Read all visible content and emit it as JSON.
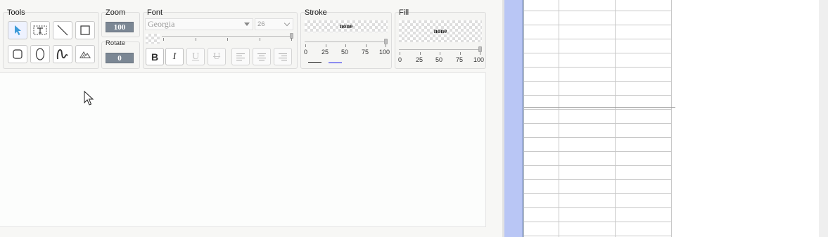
{
  "toolbar": {
    "tools": {
      "title": "Tools",
      "items": [
        {
          "name": "select-tool",
          "icon": "pointer-icon",
          "active": true
        },
        {
          "name": "text-tool",
          "icon": "text-box-icon",
          "active": false
        },
        {
          "name": "line-tool",
          "icon": "line-icon",
          "active": false
        },
        {
          "name": "rectangle-tool",
          "icon": "rectangle-icon",
          "active": false
        },
        {
          "name": "rounded-rectangle-tool",
          "icon": "rounded-rectangle-icon",
          "active": false
        },
        {
          "name": "ellipse-tool",
          "icon": "ellipse-icon",
          "active": false
        },
        {
          "name": "freehand-tool",
          "icon": "freehand-icon",
          "active": false
        },
        {
          "name": "image-tool",
          "icon": "image-icon",
          "active": false
        }
      ]
    },
    "zoom": {
      "title": "Zoom",
      "value": "100",
      "rotate_label": "Rotate",
      "rotate_value": "0"
    },
    "font": {
      "title": "Font",
      "family": "Georgia",
      "size": "26",
      "buttons": [
        {
          "name": "bold",
          "label": "B"
        },
        {
          "name": "italic",
          "label": "I"
        },
        {
          "name": "underline",
          "label": "U"
        },
        {
          "name": "strikethrough",
          "label": "U"
        },
        {
          "name": "align-left",
          "icon": "align-left-icon"
        },
        {
          "name": "align-center",
          "icon": "align-center-icon"
        },
        {
          "name": "align-right",
          "icon": "align-right-icon"
        }
      ]
    },
    "stroke": {
      "title": "Stroke",
      "color_label": "none",
      "opacity": 100,
      "ticks": [
        "0",
        "25",
        "50",
        "75",
        "100"
      ],
      "style_colors": [
        "#222222",
        "#8c8cf0"
      ]
    },
    "fill": {
      "title": "Fill",
      "color_label": "none",
      "opacity": 100,
      "ticks": [
        "0",
        "25",
        "50",
        "75",
        "100"
      ]
    }
  },
  "colors": {
    "sheet_row_header": "#b9c6f5",
    "grid_line": "#c8c8c8",
    "badge": "#7b8794"
  }
}
